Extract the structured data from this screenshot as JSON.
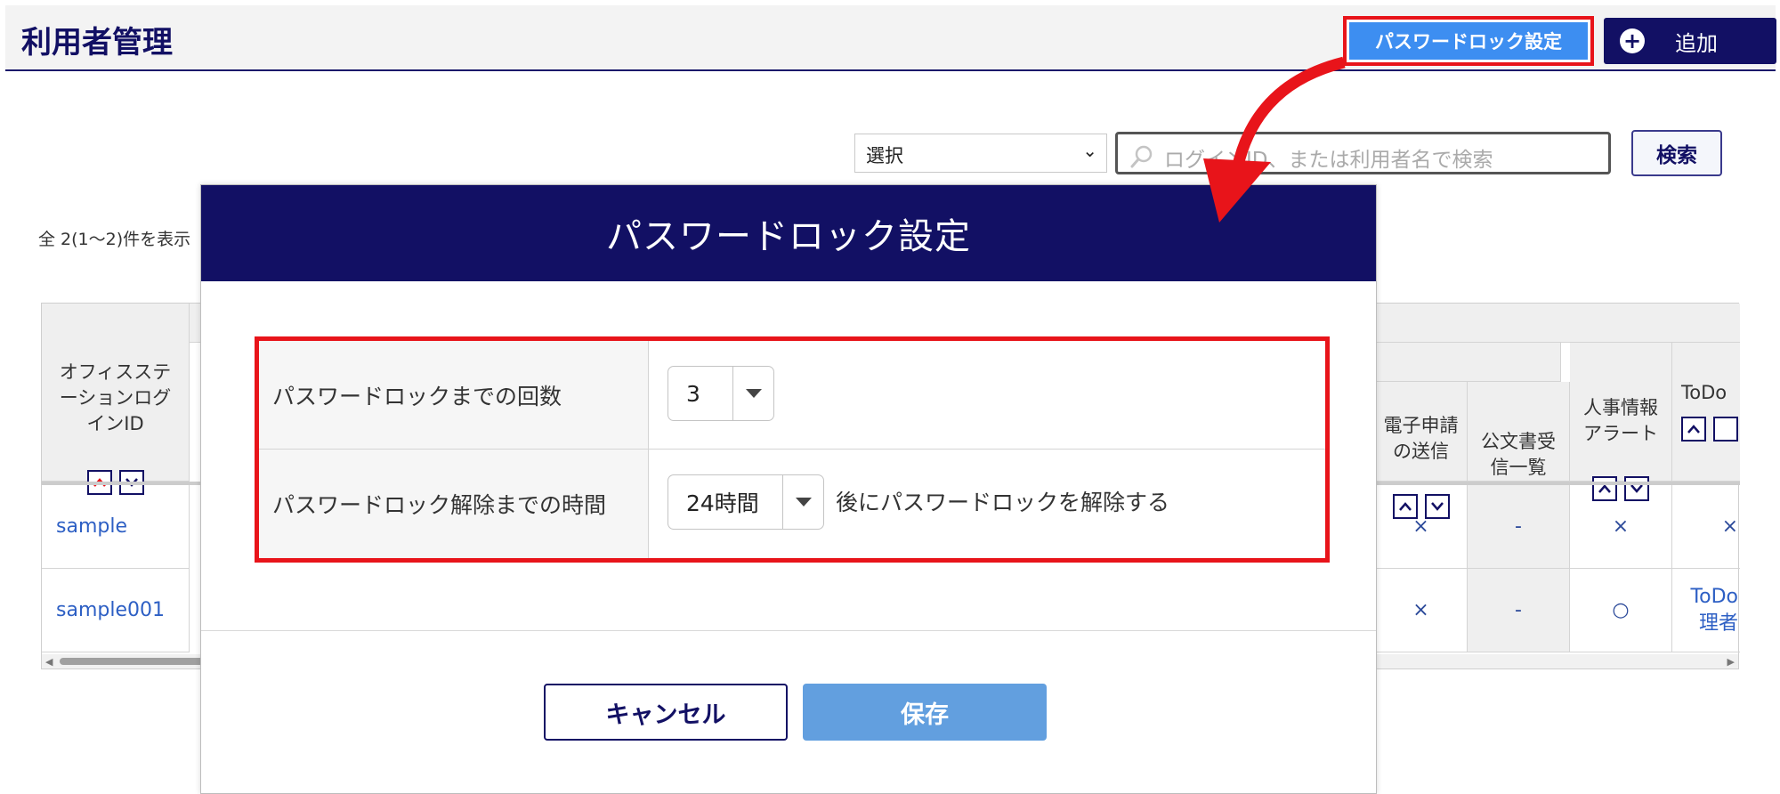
{
  "header": {
    "title": "利用者管理",
    "password_lock_button": "パスワードロック設定",
    "add_button": "追加"
  },
  "search": {
    "select_value": "選択",
    "placeholder": "ログインID、または利用者名で検索",
    "search_button": "検索"
  },
  "count_text": "全 2(1〜2)件を表示",
  "table": {
    "columns": {
      "login_id": "オフィスステ\nーションログ\nインID",
      "e_application": "電子申請\nの送信",
      "official_docs": "公文書受\n信一覧",
      "hr_alert": "人事情報\nアラート",
      "todo": "ToDo"
    },
    "rows": [
      {
        "login_id": "sample",
        "e_application": "×",
        "official_docs": "-",
        "hr_alert": "×",
        "todo": "×"
      },
      {
        "login_id": "sample001",
        "e_application": "×",
        "official_docs": "-",
        "hr_alert": "○",
        "todo": "ToDo\n理者"
      }
    ]
  },
  "modal": {
    "title": "パスワードロック設定",
    "lock_count_label": "パスワードロックまでの回数",
    "lock_count_value": "3",
    "unlock_time_label": "パスワードロック解除までの時間",
    "unlock_time_value": "24時間",
    "unlock_suffix": "後にパスワードロックを解除する",
    "cancel_button": "キャンセル",
    "save_button": "保存"
  },
  "colors": {
    "navy": "#121064",
    "highlight_red": "#e8141a",
    "lock_button_blue": "#3d8ef1",
    "save_button_blue": "#629fdf"
  }
}
